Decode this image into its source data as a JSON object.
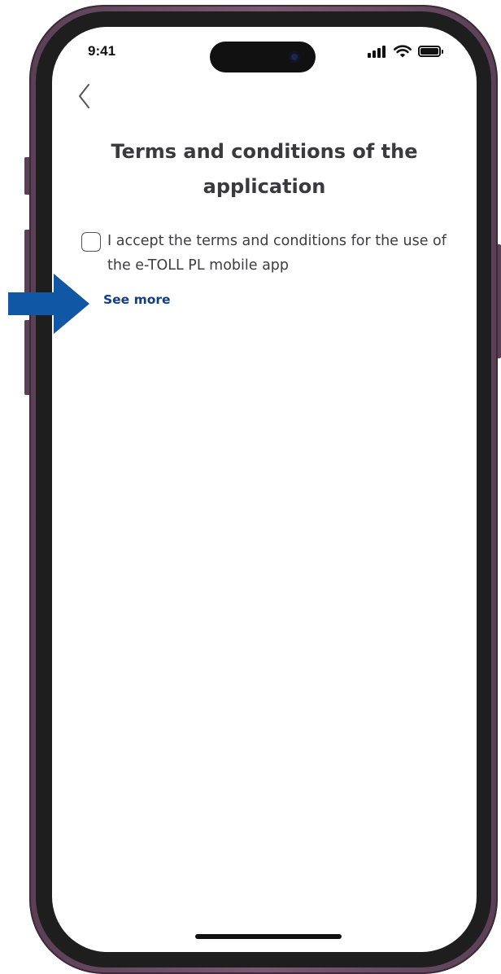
{
  "status_bar": {
    "time": "9:41",
    "icons": [
      "signal-icon",
      "wifi-icon",
      "battery-icon"
    ]
  },
  "navigation": {
    "back_icon": "chevron-left-icon"
  },
  "page": {
    "title": "Terms and conditions of the application",
    "terms_checkbox": {
      "checked": false,
      "label": "I accept the terms and conditions for the use of the e-TOLL PL mobile app"
    },
    "see_more_label": "See more"
  },
  "annotation": {
    "icon": "arrow-right-icon",
    "color": "#1057a6"
  },
  "colors": {
    "frame": "#6b4c64",
    "link": "#123f7f",
    "title": "#3a3a3d",
    "text": "#3d3d40"
  }
}
